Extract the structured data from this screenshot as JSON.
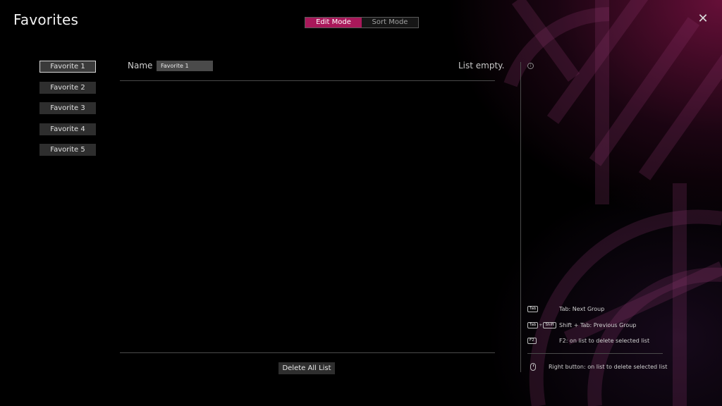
{
  "header": {
    "title": "Favorites",
    "close_glyph": "✕"
  },
  "modes": [
    {
      "label": "Edit Mode",
      "active": true
    },
    {
      "label": "Sort Mode",
      "active": false
    }
  ],
  "favorites": [
    {
      "label": "Favorite 1",
      "selected": true
    },
    {
      "label": "Favorite 2",
      "selected": false
    },
    {
      "label": "Favorite 3",
      "selected": false
    },
    {
      "label": "Favorite 4",
      "selected": false
    },
    {
      "label": "Favorite 5",
      "selected": false
    }
  ],
  "editor": {
    "name_label": "Name",
    "name_value": "Favorite 1",
    "status": "List empty.",
    "delete_all_label": "Delete All List"
  },
  "help": {
    "info_icon": "info-icon",
    "items": [
      {
        "keys": [
          "Tab"
        ],
        "text": "Tab: Next Group"
      },
      {
        "keys": [
          "Tab",
          "Shift"
        ],
        "text": "Shift + Tab: Previous Group"
      },
      {
        "keys": [
          "F2"
        ],
        "text": "F2: on list to delete selected list"
      },
      {
        "keys": [
          "mouse-icon"
        ],
        "text": "Right button: on list to delete selected list"
      }
    ]
  },
  "colors": {
    "accent": "#a8185a",
    "background": "#000000",
    "button_bg": "#2e2e2e"
  }
}
